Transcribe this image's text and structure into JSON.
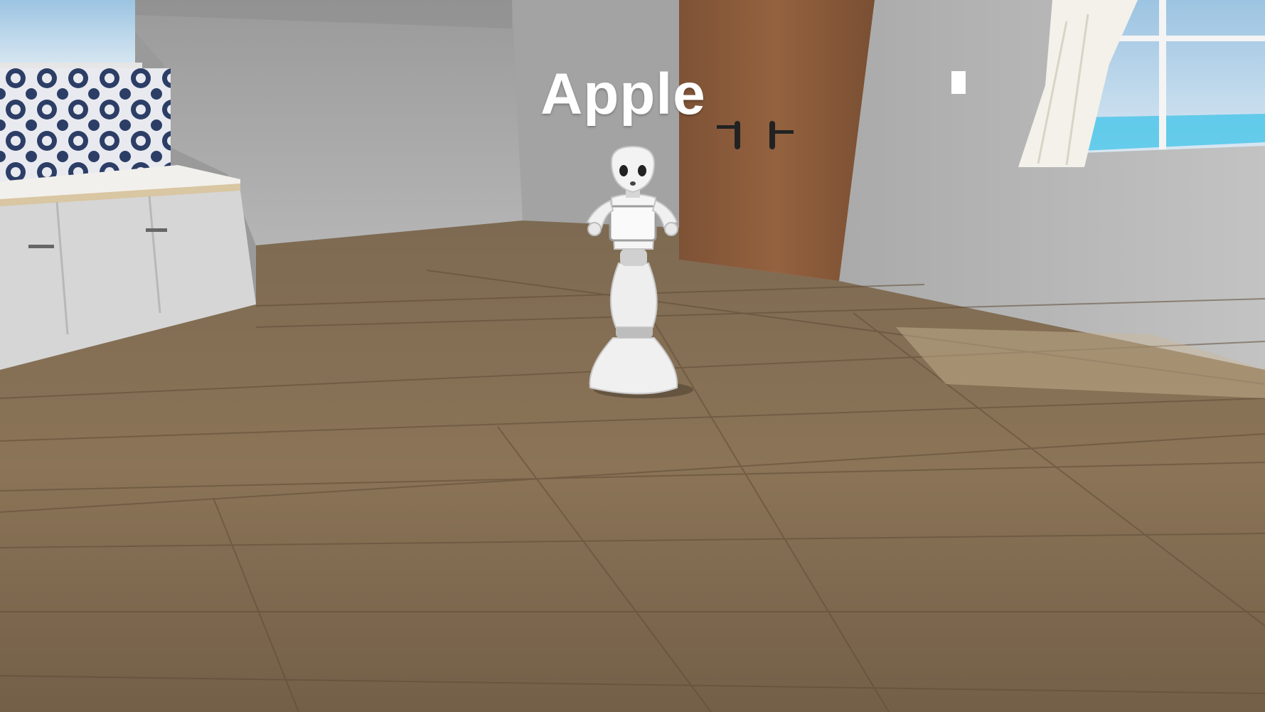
{
  "overlay": {
    "label": "Apple"
  },
  "colors": {
    "wall_back": "#a9a9a9",
    "wall_right": "#b4b4b4",
    "floor": "#8a7357",
    "door": "#8a5a3a",
    "cabinet": "#d9d9d9",
    "robot": "#f0f0f0",
    "sky": "#8fb7d9"
  },
  "icons": [
    "robot-character",
    "wooden-door",
    "kitchen-cabinet",
    "window"
  ]
}
